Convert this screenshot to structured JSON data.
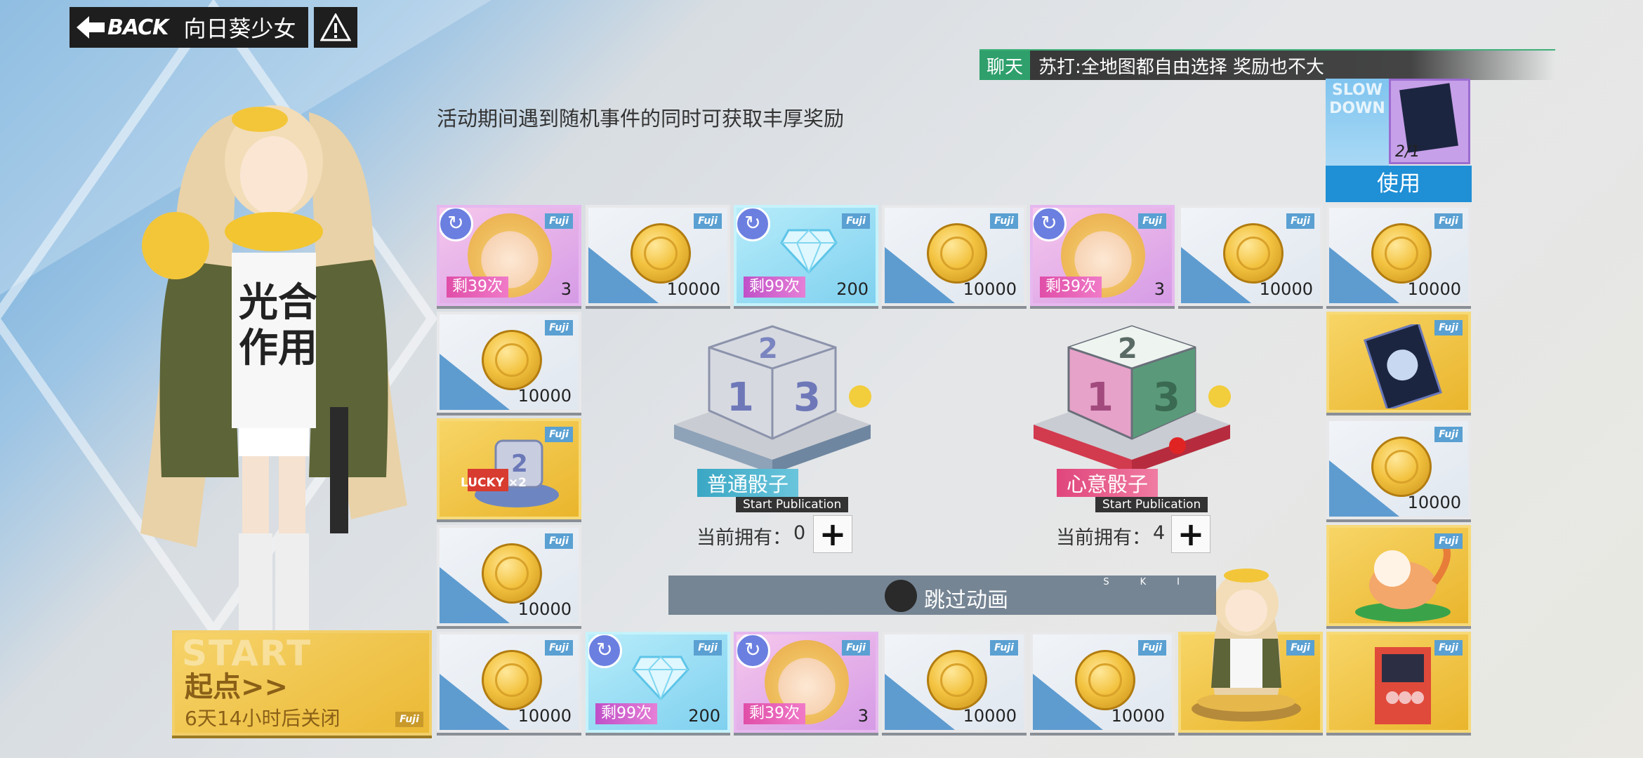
{
  "header": {
    "back_label": "BACK",
    "title": "向日葵少女"
  },
  "chat": {
    "tag": "聊天",
    "message": "苏打:全地图都自由选择  奖励也不大"
  },
  "notice": "活动期间遇到随机事件的同时可获取丰厚奖励",
  "item_use": {
    "bg_text": "SLOW DOWN",
    "count": "2/1",
    "use_label": "使用"
  },
  "dice": {
    "normal": {
      "label": "普通骰子",
      "sub": "Start Publication",
      "own_label": "当前拥有：",
      "own_count": "0",
      "plus": "+"
    },
    "heart": {
      "label": "心意骰子",
      "sub": "Start Publication",
      "own_label": "当前拥有：",
      "own_count": "4",
      "plus": "+"
    }
  },
  "skip": {
    "label": "跳过动画",
    "letters": "SKI"
  },
  "start": {
    "bg": "START",
    "label": "起点>>",
    "close": "6天14小时后关闭"
  },
  "tiles": {
    "top": [
      {
        "remain": "剩39次",
        "amount": "3"
      },
      {
        "amount": "10000"
      },
      {
        "remain": "剩99次",
        "amount": "200"
      },
      {
        "amount": "10000"
      },
      {
        "remain": "剩39次",
        "amount": "3"
      },
      {
        "amount": "10000"
      },
      {
        "amount": "10000"
      }
    ],
    "left": [
      {
        "amount": "10000"
      },
      {
        "badge": "LUCKY ×2"
      },
      {
        "amount": "10000"
      }
    ],
    "right": [
      {
        "amount": "10000"
      }
    ],
    "bottom": [
      {
        "amount": "10000"
      },
      {
        "remain": "剩99次",
        "amount": "200"
      },
      {
        "remain": "剩39次",
        "amount": "3"
      },
      {
        "amount": "10000"
      },
      {
        "amount": "10000"
      }
    ]
  },
  "colors": {
    "accent_blue": "#1f8fd6",
    "gold": "#eab52c",
    "chat_green": "#2fa06c"
  }
}
